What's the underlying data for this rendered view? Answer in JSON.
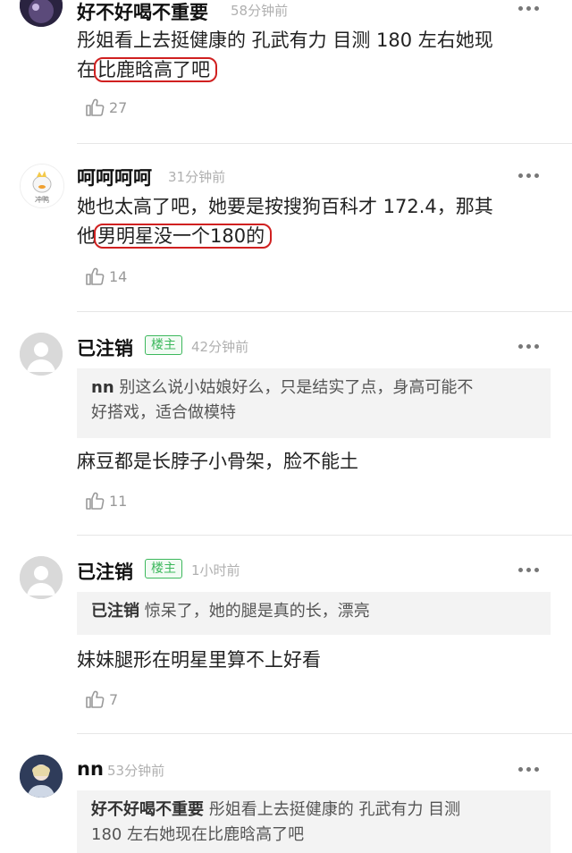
{
  "comments": [
    {
      "name": "好不好喝不重要",
      "time": "58分钟前",
      "lines": [
        "彤姐看上去挺健康的 孔武有力 目测 180 左右她现"
      ],
      "last_prefix": "在",
      "last_highlight": "比鹿晗高了吧",
      "likes": "27"
    },
    {
      "name": "呵呵呵呵",
      "time": "31分钟前",
      "avatar_text": "冲鸭",
      "lines": [
        "她也太高了吧，她要是按搜狗百科才 172.4，那其"
      ],
      "last_prefix": "他",
      "last_highlight": "男明星没一个180的",
      "likes": "14"
    },
    {
      "name": "已注销",
      "badge": "楼主",
      "time": "42分钟前",
      "quote_name": "nn",
      "quote_text": "别这么说小姑娘好么，只是结实了点，身高可能不好搭戏，适合做模特",
      "quote_line1": "别这么说小姑娘好么，只是结实了点，身高可能不",
      "quote_line2": "好搭戏，适合做模特",
      "text": "麻豆都是长脖子小骨架，脸不能土",
      "likes": "11"
    },
    {
      "name": "已注销",
      "badge": "楼主",
      "time": "1小时前",
      "quote_name": "已注销",
      "quote_text": "惊呆了，她的腿是真的长，漂亮",
      "text": "妹妹腿形在明星里算不上好看",
      "likes": "7"
    },
    {
      "name": "nn",
      "time": "53分钟前",
      "quote_name": "好不好喝不重要",
      "quote_line1": "彤姐看上去挺健康的 孔武有力 目测",
      "quote_line2": "180 左右她现在比鹿晗高了吧"
    }
  ],
  "icons": {
    "more": "more-dots-icon",
    "like": "thumbs-up-icon"
  },
  "colors": {
    "highlight_border": "#d02020",
    "badge_green": "#3cb85c",
    "time_gray": "#b0b0b0"
  }
}
